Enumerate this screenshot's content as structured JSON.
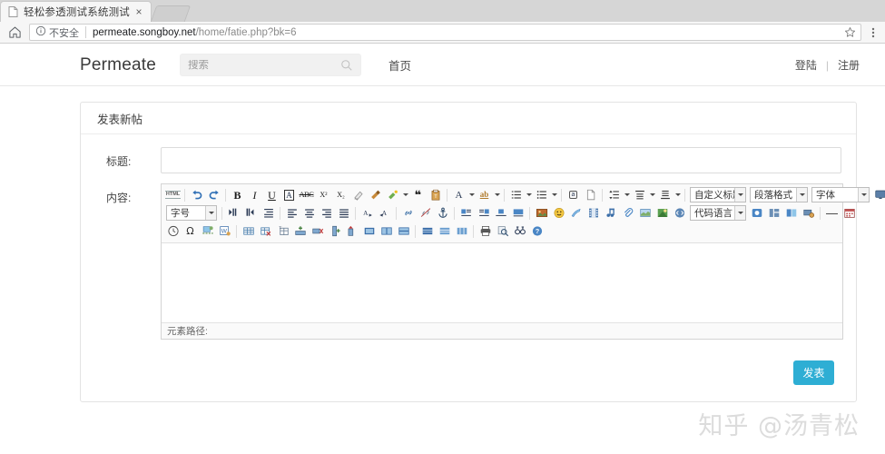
{
  "browser": {
    "tab": {
      "title": "轻松参透测试系统测试",
      "close_label": "×"
    },
    "new_tab_label": "",
    "security_label": "不安全",
    "url_domain": "permeate.songboy.net",
    "url_path": "/home/fatie.php?bk=6",
    "home_icon": "home-icon",
    "info_icon": "info-circle-icon",
    "star_icon": "star-icon",
    "menu_icon": "browser-menu-icon"
  },
  "site": {
    "brand": "Permeate",
    "search": {
      "placeholder": "搜索",
      "value": "",
      "icon": "search-icon"
    },
    "nav": [
      {
        "label": "首页"
      }
    ],
    "account": {
      "login": "登陆",
      "separator": "|",
      "register": "注册"
    }
  },
  "panel": {
    "title": "发表新帖",
    "fields": {
      "title_label": "标题:",
      "title_value": "",
      "content_label": "内容:"
    },
    "submit_label": "发表",
    "submit_color": "#2eaed4"
  },
  "editor": {
    "status_label": "元素路径:",
    "body_value": "",
    "selects": {
      "custom_heading": "自定义标题",
      "paragraph_format": "段落格式",
      "font_family": "字体",
      "font_size": "字号",
      "code_language": "代码语言"
    },
    "row1": [
      {
        "name": "source-code-icon",
        "label": "HTML"
      },
      {
        "name": "undo-icon",
        "label": ""
      },
      {
        "name": "redo-icon",
        "label": ""
      },
      {
        "name": "bold-icon",
        "label": "B"
      },
      {
        "name": "italic-icon",
        "label": "I"
      },
      {
        "name": "underline-icon",
        "label": "U"
      },
      {
        "name": "font-border-icon",
        "label": "A"
      },
      {
        "name": "strikethrough-icon",
        "label": "ABC"
      },
      {
        "name": "superscript-icon",
        "label": "X²"
      },
      {
        "name": "subscript-icon",
        "label": "X₂"
      },
      {
        "name": "remove-format-icon",
        "label": ""
      },
      {
        "name": "paint-format-icon",
        "label": ""
      },
      {
        "name": "auto-typeset-icon",
        "label": ""
      },
      {
        "name": "blockquote-icon",
        "label": "❝"
      },
      {
        "name": "paste-plain-icon",
        "label": ""
      },
      {
        "name": "font-color-icon",
        "label": "A"
      },
      {
        "name": "background-color-icon",
        "label": "ab"
      },
      {
        "name": "ordered-list-icon",
        "label": ""
      },
      {
        "name": "unordered-list-icon",
        "label": ""
      },
      {
        "name": "select-all-icon",
        "label": "a"
      },
      {
        "name": "clear-doc-icon",
        "label": ""
      },
      {
        "name": "line-height-icon",
        "label": ""
      },
      {
        "name": "paragraph-spacing-top-icon",
        "label": ""
      },
      {
        "name": "paragraph-spacing-bottom-icon",
        "label": ""
      },
      {
        "name": "fullscreen-icon",
        "label": ""
      }
    ],
    "row2": [
      {
        "name": "indent-icon",
        "label": ""
      },
      {
        "name": "outdent-icon",
        "label": ""
      },
      {
        "name": "text-indent-icon",
        "label": ""
      },
      {
        "name": "align-left-icon",
        "label": ""
      },
      {
        "name": "align-center-icon",
        "label": ""
      },
      {
        "name": "align-right-icon",
        "label": ""
      },
      {
        "name": "align-justify-icon",
        "label": ""
      },
      {
        "name": "direction-ltr-icon",
        "label": ""
      },
      {
        "name": "direction-rtl-icon",
        "label": ""
      },
      {
        "name": "link-icon",
        "label": ""
      },
      {
        "name": "unlink-icon",
        "label": ""
      },
      {
        "name": "anchor-icon",
        "label": ""
      },
      {
        "name": "image-left-float-icon",
        "label": ""
      },
      {
        "name": "image-right-float-icon",
        "label": ""
      },
      {
        "name": "image-center-icon",
        "label": ""
      },
      {
        "name": "image-none-icon",
        "label": ""
      },
      {
        "name": "insert-image-icon",
        "label": ""
      },
      {
        "name": "emoticon-icon",
        "label": ""
      },
      {
        "name": "scrawl-icon",
        "label": ""
      },
      {
        "name": "insert-video-icon",
        "label": ""
      },
      {
        "name": "music-icon",
        "label": ""
      },
      {
        "name": "attachment-icon",
        "label": ""
      },
      {
        "name": "map-icon",
        "label": ""
      },
      {
        "name": "gmap-icon",
        "label": ""
      },
      {
        "name": "insert-code-icon",
        "label": ""
      },
      {
        "name": "webapp-icon",
        "label": ""
      },
      {
        "name": "template-icon",
        "label": ""
      },
      {
        "name": "background-icon",
        "label": ""
      },
      {
        "name": "snapscreen-icon",
        "label": ""
      },
      {
        "name": "horizontal-rule-icon",
        "label": "—"
      },
      {
        "name": "calendar-icon",
        "label": ""
      }
    ],
    "row3": [
      {
        "name": "insert-time-icon",
        "label": ""
      },
      {
        "name": "special-character-icon",
        "label": "Ω"
      },
      {
        "name": "page-break-icon",
        "label": ""
      },
      {
        "name": "word-import-icon",
        "label": ""
      },
      {
        "name": "insert-table-icon",
        "label": ""
      },
      {
        "name": "delete-table-icon",
        "label": ""
      },
      {
        "name": "table-properties-icon",
        "label": ""
      },
      {
        "name": "insert-row-icon",
        "label": ""
      },
      {
        "name": "delete-row-icon",
        "label": ""
      },
      {
        "name": "insert-column-icon",
        "label": ""
      },
      {
        "name": "delete-column-icon",
        "label": ""
      },
      {
        "name": "merge-cells-icon",
        "label": ""
      },
      {
        "name": "split-cells-icon",
        "label": ""
      },
      {
        "name": "merge-right-icon",
        "label": ""
      },
      {
        "name": "merge-down-icon",
        "label": ""
      },
      {
        "name": "split-to-rows-icon",
        "label": ""
      },
      {
        "name": "split-to-cols-icon",
        "label": ""
      },
      {
        "name": "print-icon",
        "label": ""
      },
      {
        "name": "preview-icon",
        "label": ""
      },
      {
        "name": "search-replace-icon",
        "label": ""
      },
      {
        "name": "help-icon",
        "label": "?"
      }
    ]
  },
  "watermark": {
    "text": "知乎 @汤青松"
  }
}
